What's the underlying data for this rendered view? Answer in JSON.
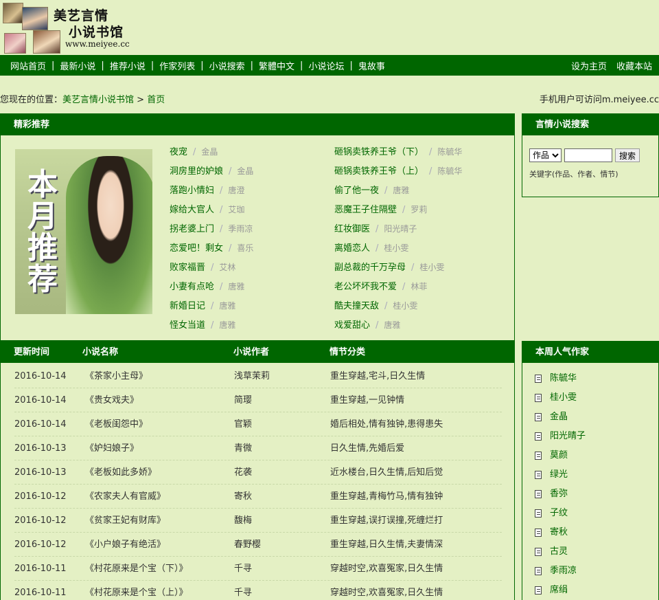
{
  "header": {
    "logo_line1": "美艺言情",
    "logo_line2": "小说书馆",
    "logo_url": "www.meiyee.cc"
  },
  "nav": {
    "items": [
      "网站首页",
      "最新小说",
      "推荐小说",
      "作家列表",
      "小说搜索",
      "繁體中文",
      "小说论坛",
      "鬼故事"
    ],
    "separator": "|",
    "right": [
      "设为主页",
      "收藏本站"
    ]
  },
  "breadcrumb": {
    "prefix": "您现在的位置：",
    "site": "美艺言情小说书馆",
    "arrow": " > ",
    "current": "首页",
    "mobile_note": "手机用户可访问m.meiyee.cc"
  },
  "recommend": {
    "title": "精彩推荐",
    "image_text": [
      "本",
      "月",
      "推",
      "荐"
    ],
    "slash": "/",
    "col1": [
      {
        "title": "夜宠",
        "author": "金晶"
      },
      {
        "title": "洞房里的妒娘",
        "author": "金晶"
      },
      {
        "title": "落跑小情妇",
        "author": "唐澄"
      },
      {
        "title": "嫁给大官人",
        "author": "艾珈"
      },
      {
        "title": "拐老婆上门",
        "author": "季雨凉"
      },
      {
        "title": "恋爱吧！剩女",
        "author": "喜乐"
      },
      {
        "title": "败家福晋",
        "author": "艾林"
      },
      {
        "title": "小妻有点呛",
        "author": "唐雅"
      },
      {
        "title": "新婚日记",
        "author": "唐雅"
      },
      {
        "title": "怪女当道",
        "author": "唐雅"
      }
    ],
    "col2": [
      {
        "title": "砸锅卖铁养王爷（下）",
        "author": "陈毓华"
      },
      {
        "title": "砸锅卖铁养王爷（上）",
        "author": "陈毓华"
      },
      {
        "title": "偷了他一夜",
        "author": "唐雅"
      },
      {
        "title": "恶魔王子住隔壁",
        "author": "罗莉"
      },
      {
        "title": "红妆御医",
        "author": "阳光晴子"
      },
      {
        "title": "离婚恋人",
        "author": "桂小雯"
      },
      {
        "title": "副总裁的千万孕母",
        "author": "桂小雯"
      },
      {
        "title": "老公坏坏我不爱",
        "author": "林菲"
      },
      {
        "title": "酷夫撞天敌",
        "author": "桂小雯"
      },
      {
        "title": "戏爱甜心",
        "author": "唐雅"
      }
    ]
  },
  "search": {
    "title": "言情小说搜索",
    "select_value": "作品",
    "input_value": "",
    "button": "搜索",
    "hint": "关键字(作品、作者、情节)"
  },
  "updates": {
    "headers": [
      "更新时间",
      "小说名称",
      "小说作者",
      "情节分类"
    ],
    "rows": [
      {
        "date": "2016-10-14",
        "name": "《茶家小主母》",
        "author": "浅草茉莉",
        "genre": "重生穿越,宅斗,日久生情"
      },
      {
        "date": "2016-10-14",
        "name": "《贵女戏夫》",
        "author": "简璎",
        "genre": "重生穿越,一见钟情"
      },
      {
        "date": "2016-10-14",
        "name": "《老板闺怨中》",
        "author": "官颖",
        "genre": "婚后相处,情有独钟,患得患失"
      },
      {
        "date": "2016-10-13",
        "name": "《妒妇娘子》",
        "author": "青微",
        "genre": "日久生情,先婚后爱"
      },
      {
        "date": "2016-10-13",
        "name": "《老板如此多娇》",
        "author": "花袭",
        "genre": "近水楼台,日久生情,后知后觉"
      },
      {
        "date": "2016-10-12",
        "name": "《农家夫人有官威》",
        "author": "寄秋",
        "genre": "重生穿越,青梅竹马,情有独钟"
      },
      {
        "date": "2016-10-12",
        "name": "《贫家王妃有财库》",
        "author": "馥梅",
        "genre": "重生穿越,误打误撞,死缠烂打"
      },
      {
        "date": "2016-10-12",
        "name": "《小户娘子有绝活》",
        "author": "春野樱",
        "genre": "重生穿越,日久生情,夫妻情深"
      },
      {
        "date": "2016-10-11",
        "name": "《村花原来是个宝（下）》",
        "author": "千寻",
        "genre": "穿越时空,欢喜冤家,日久生情"
      },
      {
        "date": "2016-10-11",
        "name": "《村花原来是个宝（上）》",
        "author": "千寻",
        "genre": "穿越时空,欢喜冤家,日久生情"
      }
    ]
  },
  "popular": {
    "title": "本周人气作家",
    "authors": [
      "陈毓华",
      "桂小雯",
      "金晶",
      "阳光晴子",
      "莫颜",
      "绿光",
      "香弥",
      "子纹",
      "寄秋",
      "古灵",
      "季雨凉",
      "席绢"
    ]
  }
}
